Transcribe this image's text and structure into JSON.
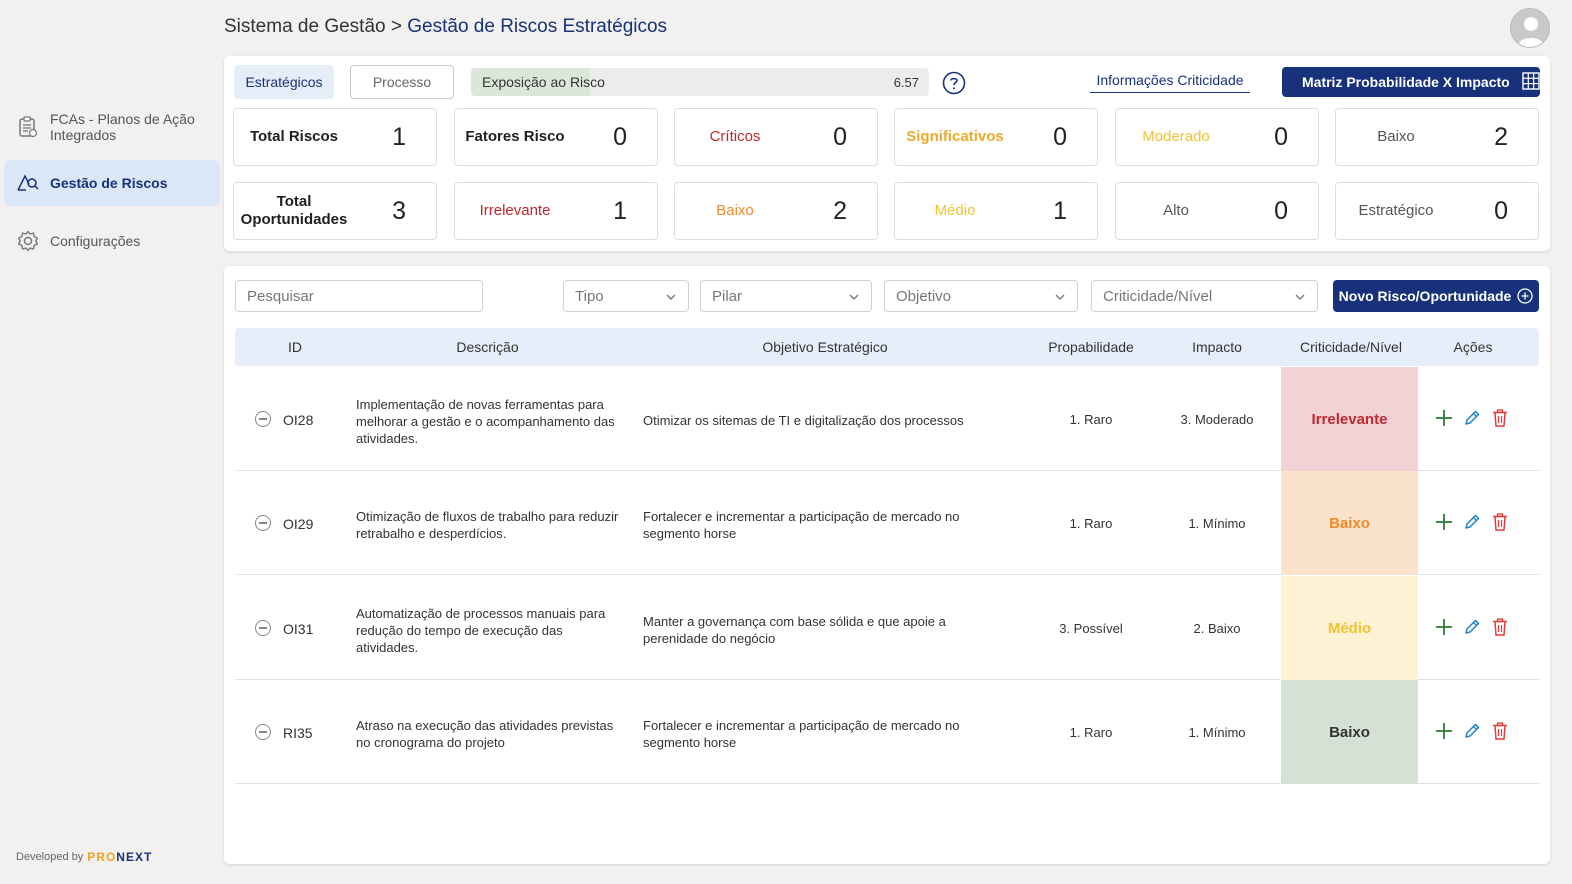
{
  "sidebar": {
    "items": [
      {
        "label": "FCAs - Planos de Ação Integrados",
        "icon": "clipboard-icon"
      },
      {
        "label": "Gestão de Riscos",
        "icon": "risk-search-icon"
      },
      {
        "label": "Configurações",
        "icon": "gear-icon"
      }
    ],
    "footer": {
      "prefix": "Developed by",
      "brand_part1": "PRO",
      "brand_part2": "NEXT"
    }
  },
  "header": {
    "breadcrumb_root": "Sistema de Gestão",
    "separator": ">",
    "breadcrumb_current": "Gestão de Riscos Estratégicos"
  },
  "top": {
    "tabs": [
      "Estratégicos",
      "Processo"
    ],
    "exposure": {
      "label": "Exposição ao Risco",
      "value": "6.57",
      "fill_fraction": 0.26
    },
    "info_link": "Informações Criticidade",
    "matrix_button": "Matriz Probabilidade X Impacto",
    "stats_row1": [
      {
        "label": "Total Riscos",
        "value": "1"
      },
      {
        "label": "Fatores Risco",
        "value": "0"
      },
      {
        "label": "Críticos",
        "value": "0"
      },
      {
        "label": "Significativos",
        "value": "0"
      },
      {
        "label": "Moderado",
        "value": "0"
      },
      {
        "label": "Baixo",
        "value": "2"
      }
    ],
    "stats_row2": [
      {
        "label": "Total Oportunidades",
        "value": "3"
      },
      {
        "label": "Irrelevante",
        "value": "1"
      },
      {
        "label": "Baixo",
        "value": "2"
      },
      {
        "label": "Médio",
        "value": "1"
      },
      {
        "label": "Alto",
        "value": "0"
      },
      {
        "label": "Estratégico",
        "value": "0"
      }
    ]
  },
  "filters": {
    "search_placeholder": "Pesquisar",
    "tipo": "Tipo",
    "pilar": "Pilar",
    "objetivo": "Objetivo",
    "criticidade": "Criticidade/Nível",
    "new_button": "Novo Risco/Oportunidade"
  },
  "table": {
    "columns": [
      "ID",
      "Descrição",
      "Objetivo Estratégico",
      "Propabilidade",
      "Impacto",
      "Criticidade/Nível",
      "Ações"
    ],
    "rows": [
      {
        "id": "OI28",
        "descricao": "Implementação de novas ferramentas para melhorar a gestão e o acompanhamento das atividades.",
        "objetivo": "Otimizar os sitemas de TI e digitalização dos processos",
        "probabilidade": "1. Raro",
        "impacto": "3. Moderado",
        "criticidade": "Irrelevante",
        "crit_bg": "#f1d3d6",
        "crit_color": "#c0282f"
      },
      {
        "id": "OI29",
        "descricao": "Otimização de fluxos de trabalho para reduzir retrabalho e desperdícios.",
        "objetivo": "Fortalecer e incrementar a participação de mercado no segmento horse",
        "probabilidade": "1. Raro",
        "impacto": "1. Mínimo",
        "criticidade": "Baixo",
        "crit_bg": "#fbe3cb",
        "crit_color": "#ef8a2a"
      },
      {
        "id": "OI31",
        "descricao": "Automatização de processos manuais para redução do tempo de execução das atividades.",
        "objetivo": "Manter a governança com base sólida e que apoie a perenidade do negócio",
        "probabilidade": "3. Possível",
        "impacto": "2. Baixo",
        "criticidade": "Médio",
        "crit_bg": "#fdf2d4",
        "crit_color": "#f2c230"
      },
      {
        "id": "RI35",
        "descricao": "Atraso na execução das atividades previstas no cronograma do projeto",
        "objetivo": "Fortalecer e incrementar a participação de mercado no segmento horse",
        "probabilidade": "1. Raro",
        "impacto": "1. Mínimo",
        "criticidade": "Baixo",
        "crit_bg": "#d6e1d6",
        "crit_color": "#333333"
      }
    ]
  },
  "colors": {
    "brand": "#17327a",
    "add": "#2e7d32",
    "edit": "#1e7fd0",
    "delete": "#e53935"
  }
}
